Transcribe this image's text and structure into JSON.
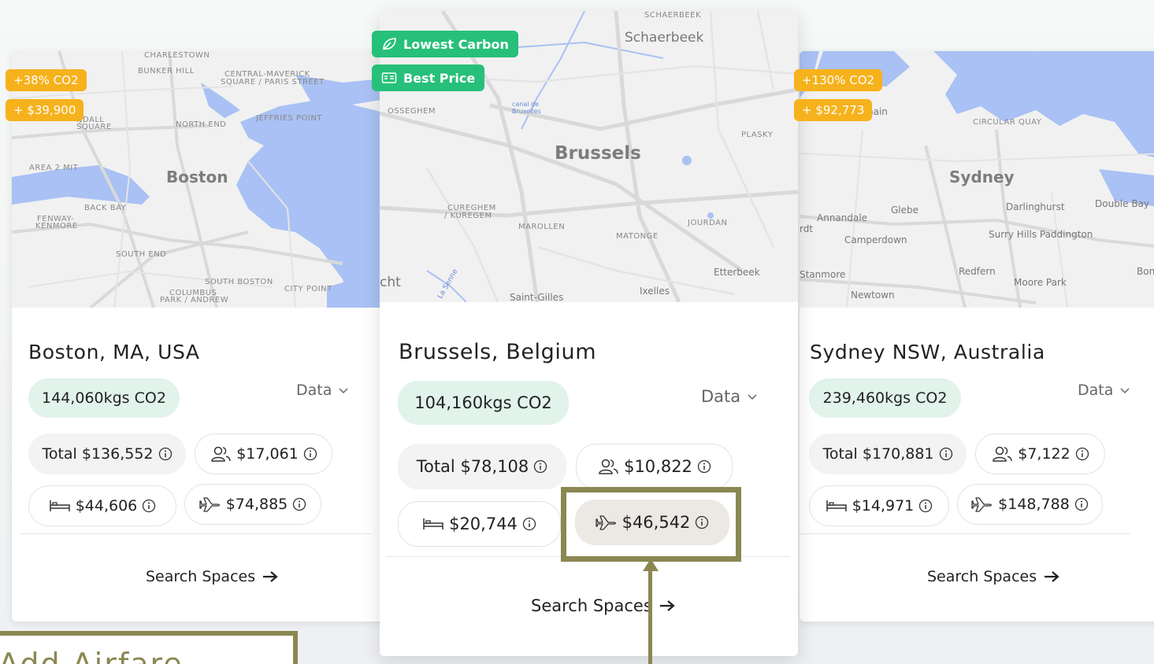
{
  "colors": {
    "co2_pill_bg": "#e1f3eb",
    "badge_orange": "#f6b21c",
    "badge_green": "#27c07a",
    "highlight_olive": "#8b8752",
    "water_blue": "#a9c1f4"
  },
  "cards": {
    "boston": {
      "map": {
        "city": "Boston",
        "labels": [
          "CHARLESTOWN",
          "BUNKER HILL",
          "CENTRAL-MAVERICK",
          "SQUARE / PARIS STREET",
          "JEFFRIES POINT",
          "NORTH END",
          "AREA 2 MIT",
          "BACK BAY",
          "FENWAY-",
          "KENMORE",
          "SOUTH END",
          "SOUTH BOSTON",
          "COLUMBUS",
          "PARK / ANDREW",
          "CITY POINT",
          "NDALL",
          "SQUARE"
        ]
      },
      "badges": [
        "+38% CO2",
        "+ $39,900"
      ],
      "title": "Boston, MA, USA",
      "co2": "144,060kgs CO2",
      "data_label": "Data",
      "total": "Total $136,552",
      "people_cost": "$17,061",
      "lodging_cost": "$44,606",
      "airfare_cost": "$74,885",
      "search_label": "Search Spaces"
    },
    "brussels": {
      "map": {
        "city": "Brussels",
        "labels": [
          "SCHAERBEEK",
          "OSSEGHEM",
          "PLASKY",
          "CUREGHEM",
          "/ KUREGEM",
          "MAROLLEN",
          "MATONGE",
          "JOURDAN"
        ],
        "subs": [
          "Schaerbeek",
          "Etterbeek",
          "Ixelles",
          "Saint-Gilles",
          "cht",
          "La Senne",
          "canal de",
          "Bruxelles"
        ]
      },
      "badges": [
        "Lowest Carbon",
        "Best Price"
      ],
      "badge_icons": [
        "leaf-icon",
        "price-tag-icon"
      ],
      "title": "Brussels, Belgium",
      "co2": "104,160kgs CO2",
      "data_label": "Data",
      "total": "Total $78,108",
      "people_cost": "$10,822",
      "lodging_cost": "$20,744",
      "airfare_cost": "$46,542",
      "search_label": "Search Spaces"
    },
    "sydney": {
      "map": {
        "city": "Sydney",
        "labels": [
          "CIRCULAR QUAY"
        ],
        "subs": [
          "nain",
          "Glebe",
          "Darlinghurst",
          "Double Bay",
          "Annandale",
          "Camperdown",
          "Surry Hills Paddington",
          "rdt",
          "Stanmore",
          "Redfern",
          "Moore Park",
          "Newtown",
          "Bon"
        ]
      },
      "badges": [
        "+130% CO2",
        "+ $92,773"
      ],
      "title": "Sydney NSW, Australia",
      "co2": "239,460kgs CO2",
      "data_label": "Data",
      "total": "Total $170,881",
      "people_cost": "$7,122",
      "lodging_cost": "$14,971",
      "airfare_cost": "$148,788",
      "search_label": "Search Spaces"
    }
  },
  "callout": {
    "text": "Add Airfare"
  }
}
